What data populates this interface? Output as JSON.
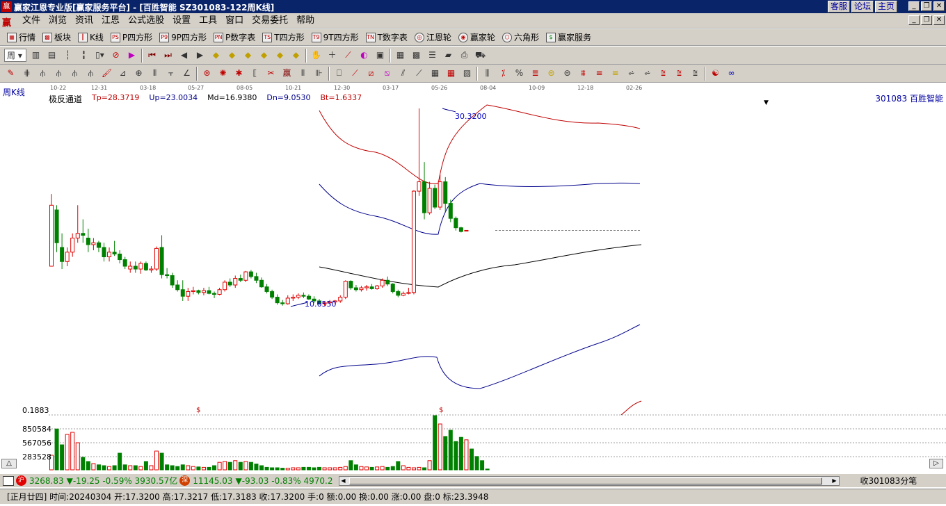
{
  "window": {
    "app_title": "赢家江恩专业版[赢家服务平台] - [百胜智能  SZ301083-122周K线]",
    "links": [
      "客服",
      "论坛",
      "主页"
    ]
  },
  "menu": [
    "文件",
    "浏览",
    "资讯",
    "江恩",
    "公式选股",
    "设置",
    "工具",
    "窗口",
    "交易委托",
    "帮助"
  ],
  "toolbar1": [
    "行情",
    "板块",
    "K线",
    "P四方形",
    "9P四方形",
    "P数字表",
    "T四方形",
    "9T四方形",
    "T数字表",
    "江恩轮",
    "赢家轮",
    "六角形",
    "赢家服务"
  ],
  "toolbar1_icons": [
    "PS",
    "P9",
    "PN",
    "TS",
    "T9",
    "TN"
  ],
  "period_selector": "周",
  "chart": {
    "period_label": "周K线",
    "date_ticks": [
      "10-22",
      "12-31",
      "03-18",
      "05-27",
      "08-05",
      "10-21",
      "12-30",
      "03-17",
      "05-26",
      "08-04",
      "10-09",
      "12-18",
      "02-26"
    ],
    "indicator_name": "极反通道",
    "tp": "Tp=28.3719",
    "up": "Up=23.0034",
    "md": "Md=16.9380",
    "dn": "Dn=9.0530",
    "bt": "Bt=1.6337",
    "stock": "301083  百胜智能",
    "high_annot": "30.3200",
    "low_annot": "10.6550",
    "volume_levels": [
      "0.1883",
      "850584",
      "567056",
      "283528"
    ],
    "dollar_marks": [
      "$",
      "$"
    ]
  },
  "status": {
    "sh_badge": "沪",
    "sh_text": "3268.83",
    "sh_change": "▼-19.25 -0.59% 3930.57亿",
    "sz_badge": "深",
    "sz_text": "11145.03",
    "sz_change": "▼-93.03 -0.83% 4970.2",
    "right_text": "收301083分笔"
  },
  "info": "[正月廿四] 时间:20240304 开:17.3200 高:17.3217 低:17.3183 收:17.3200 手:0 额:0.00 换:0.00 涨:0.00 盘:0 标:23.3948",
  "colors": {
    "up": "#e00000",
    "down": "#008000",
    "channel_outer": "#c00000",
    "channel_inner": "#00008b",
    "mid": "#000000"
  },
  "chart_data": {
    "type": "candlestick",
    "candles": [
      {
        "o": 13.5,
        "h": 21.2,
        "l": 13.5,
        "c": 20.0
      },
      {
        "o": 19.5,
        "h": 20.0,
        "l": 15.0,
        "c": 16.0
      },
      {
        "o": 15.5,
        "h": 17.0,
        "l": 13.2,
        "c": 14.0
      },
      {
        "o": 14.0,
        "h": 15.5,
        "l": 13.5,
        "c": 15.0
      },
      {
        "o": 15.0,
        "h": 17.0,
        "l": 14.5,
        "c": 16.5
      },
      {
        "o": 16.5,
        "h": 20.0,
        "l": 16.0,
        "c": 17.0
      },
      {
        "o": 17.0,
        "h": 18.5,
        "l": 16.0,
        "c": 16.8
      },
      {
        "o": 16.5,
        "h": 17.5,
        "l": 15.0,
        "c": 15.8
      },
      {
        "o": 15.8,
        "h": 16.5,
        "l": 15.2,
        "c": 16.0
      },
      {
        "o": 16.0,
        "h": 16.2,
        "l": 15.0,
        "c": 15.5
      },
      {
        "o": 15.5,
        "h": 16.0,
        "l": 14.0,
        "c": 14.5
      },
      {
        "o": 14.5,
        "h": 15.5,
        "l": 14.0,
        "c": 15.0
      },
      {
        "o": 15.0,
        "h": 16.2,
        "l": 14.6,
        "c": 14.8
      },
      {
        "o": 14.8,
        "h": 15.2,
        "l": 13.8,
        "c": 14.2
      },
      {
        "o": 14.2,
        "h": 14.5,
        "l": 13.2,
        "c": 13.5
      },
      {
        "o": 13.2,
        "h": 14.0,
        "l": 12.8,
        "c": 13.5
      },
      {
        "o": 13.5,
        "h": 14.0,
        "l": 12.8,
        "c": 13.2
      },
      {
        "o": 13.2,
        "h": 14.0,
        "l": 12.7,
        "c": 13.8
      },
      {
        "o": 13.8,
        "h": 14.0,
        "l": 13.0,
        "c": 13.1
      },
      {
        "o": 13.1,
        "h": 13.5,
        "l": 12.8,
        "c": 13.2
      },
      {
        "o": 13.2,
        "h": 15.6,
        "l": 13.0,
        "c": 15.4
      },
      {
        "o": 15.5,
        "h": 16.8,
        "l": 12.2,
        "c": 12.6
      },
      {
        "o": 12.6,
        "h": 13.3,
        "l": 12.2,
        "c": 12.5
      },
      {
        "o": 12.5,
        "h": 12.8,
        "l": 11.2,
        "c": 11.5
      },
      {
        "o": 11.5,
        "h": 12.0,
        "l": 10.8,
        "c": 11.0
      },
      {
        "o": 11.0,
        "h": 12.0,
        "l": 9.8,
        "c": 10.3
      },
      {
        "o": 10.3,
        "h": 11.2,
        "l": 9.8,
        "c": 10.8
      },
      {
        "o": 10.8,
        "h": 11.3,
        "l": 10.5,
        "c": 10.9
      },
      {
        "o": 10.9,
        "h": 11.0,
        "l": 10.5,
        "c": 10.7
      },
      {
        "o": 10.7,
        "h": 11.2,
        "l": 10.4,
        "c": 10.9
      },
      {
        "o": 10.9,
        "h": 11.3,
        "l": 10.5,
        "c": 10.6
      },
      {
        "o": 10.6,
        "h": 10.8,
        "l": 10.1,
        "c": 10.5
      },
      {
        "o": 10.5,
        "h": 11.2,
        "l": 10.4,
        "c": 11.0
      },
      {
        "o": 11.0,
        "h": 12.0,
        "l": 10.8,
        "c": 11.8
      },
      {
        "o": 11.8,
        "h": 12.2,
        "l": 11.3,
        "c": 11.5
      },
      {
        "o": 11.5,
        "h": 12.5,
        "l": 11.2,
        "c": 12.2
      },
      {
        "o": 12.2,
        "h": 12.6,
        "l": 11.8,
        "c": 12.0
      },
      {
        "o": 12.0,
        "h": 13.0,
        "l": 11.8,
        "c": 12.9
      },
      {
        "o": 12.9,
        "h": 13.1,
        "l": 12.2,
        "c": 12.4
      },
      {
        "o": 12.4,
        "h": 12.8,
        "l": 11.7,
        "c": 12.0
      },
      {
        "o": 12.0,
        "h": 12.3,
        "l": 11.2,
        "c": 11.3
      },
      {
        "o": 11.3,
        "h": 11.6,
        "l": 10.6,
        "c": 10.8
      },
      {
        "o": 10.8,
        "h": 11.0,
        "l": 10.0,
        "c": 10.2
      },
      {
        "o": 10.2,
        "h": 10.5,
        "l": 9.4,
        "c": 9.6
      },
      {
        "o": 9.6,
        "h": 9.9,
        "l": 9.3,
        "c": 9.5
      },
      {
        "o": 9.5,
        "h": 10.4,
        "l": 9.4,
        "c": 10.1
      },
      {
        "o": 10.1,
        "h": 10.5,
        "l": 9.8,
        "c": 10.2
      },
      {
        "o": 10.2,
        "h": 10.6,
        "l": 10.0,
        "c": 10.4
      },
      {
        "o": 10.4,
        "h": 10.7,
        "l": 10.1,
        "c": 10.3
      },
      {
        "o": 10.3,
        "h": 10.5,
        "l": 9.9,
        "c": 10.0
      },
      {
        "o": 10.0,
        "h": 10.3,
        "l": 9.6,
        "c": 9.8
      },
      {
        "o": 9.8,
        "h": 10.0,
        "l": 9.4,
        "c": 9.5
      },
      {
        "o": 9.5,
        "h": 9.7,
        "l": 9.3,
        "c": 9.6
      },
      {
        "o": 9.6,
        "h": 9.9,
        "l": 9.4,
        "c": 9.7
      },
      {
        "o": 9.7,
        "h": 9.9,
        "l": 9.5,
        "c": 9.8
      },
      {
        "o": 9.8,
        "h": 10.4,
        "l": 9.6,
        "c": 10.2
      },
      {
        "o": 10.2,
        "h": 12.0,
        "l": 10.0,
        "c": 11.9
      },
      {
        "o": 11.9,
        "h": 12.0,
        "l": 11.0,
        "c": 11.2
      },
      {
        "o": 11.2,
        "h": 11.5,
        "l": 10.8,
        "c": 11.0
      },
      {
        "o": 11.0,
        "h": 11.4,
        "l": 10.8,
        "c": 11.2
      },
      {
        "o": 11.2,
        "h": 11.5,
        "l": 10.9,
        "c": 11.3
      },
      {
        "o": 11.3,
        "h": 11.6,
        "l": 11.0,
        "c": 11.1
      },
      {
        "o": 11.1,
        "h": 11.5,
        "l": 11.0,
        "c": 11.4
      },
      {
        "o": 11.4,
        "h": 12.2,
        "l": 11.2,
        "c": 12.0
      },
      {
        "o": 12.0,
        "h": 12.4,
        "l": 11.4,
        "c": 11.6
      },
      {
        "o": 11.6,
        "h": 11.7,
        "l": 10.6,
        "c": 10.8
      },
      {
        "o": 10.8,
        "h": 11.0,
        "l": 10.2,
        "c": 10.4
      },
      {
        "o": 10.4,
        "h": 10.8,
        "l": 10.3,
        "c": 10.6
      },
      {
        "o": 10.6,
        "h": 11.2,
        "l": 10.5,
        "c": 10.7
      },
      {
        "o": 10.7,
        "h": 21.6,
        "l": 10.5,
        "c": 21.5
      },
      {
        "o": 21.5,
        "h": 30.32,
        "l": 21.0,
        "c": 22.5
      },
      {
        "o": 22.5,
        "h": 24.6,
        "l": 18.5,
        "c": 19.2
      },
      {
        "o": 19.2,
        "h": 22.5,
        "l": 19.0,
        "c": 21.8
      },
      {
        "o": 21.8,
        "h": 22.2,
        "l": 19.6,
        "c": 19.8
      },
      {
        "o": 19.8,
        "h": 23.3,
        "l": 19.5,
        "c": 22.5
      },
      {
        "o": 22.5,
        "h": 23.0,
        "l": 19.2,
        "c": 20.2
      },
      {
        "o": 20.2,
        "h": 20.6,
        "l": 18.2,
        "c": 18.6
      },
      {
        "o": 18.6,
        "h": 18.8,
        "l": 17.3,
        "c": 17.6
      },
      {
        "o": 17.6,
        "h": 17.7,
        "l": 17.1,
        "c": 17.2
      },
      {
        "o": 17.32,
        "h": 17.3217,
        "l": 17.3183,
        "c": 17.32
      }
    ],
    "volume_ticks": [
      0.1883,
      850584,
      567056,
      283528
    ],
    "volumes": [
      0.35,
      0.98,
      0.6,
      0.85,
      0.9,
      0.65,
      0.3,
      0.2,
      0.15,
      0.12,
      0.1,
      0.08,
      0.1,
      0.4,
      0.12,
      0.1,
      0.1,
      0.08,
      0.2,
      0.1,
      0.45,
      0.4,
      0.12,
      0.1,
      0.08,
      0.12,
      0.1,
      0.08,
      0.07,
      0.06,
      0.06,
      0.1,
      0.18,
      0.2,
      0.18,
      0.22,
      0.18,
      0.2,
      0.18,
      0.14,
      0.1,
      0.06,
      0.05,
      0.05,
      0.04,
      0.04,
      0.05,
      0.05,
      0.06,
      0.06,
      0.05,
      0.06,
      0.05,
      0.05,
      0.05,
      0.06,
      0.08,
      0.22,
      0.12,
      0.08,
      0.07,
      0.06,
      0.07,
      0.08,
      0.06,
      0.08,
      0.2,
      0.1,
      0.06,
      0.05,
      0.06,
      0.05,
      0.22,
      1.3,
      1.1,
      0.8,
      0.95,
      0.68,
      0.78,
      0.72,
      0.5,
      0.32,
      0.22,
      0.02
    ]
  }
}
